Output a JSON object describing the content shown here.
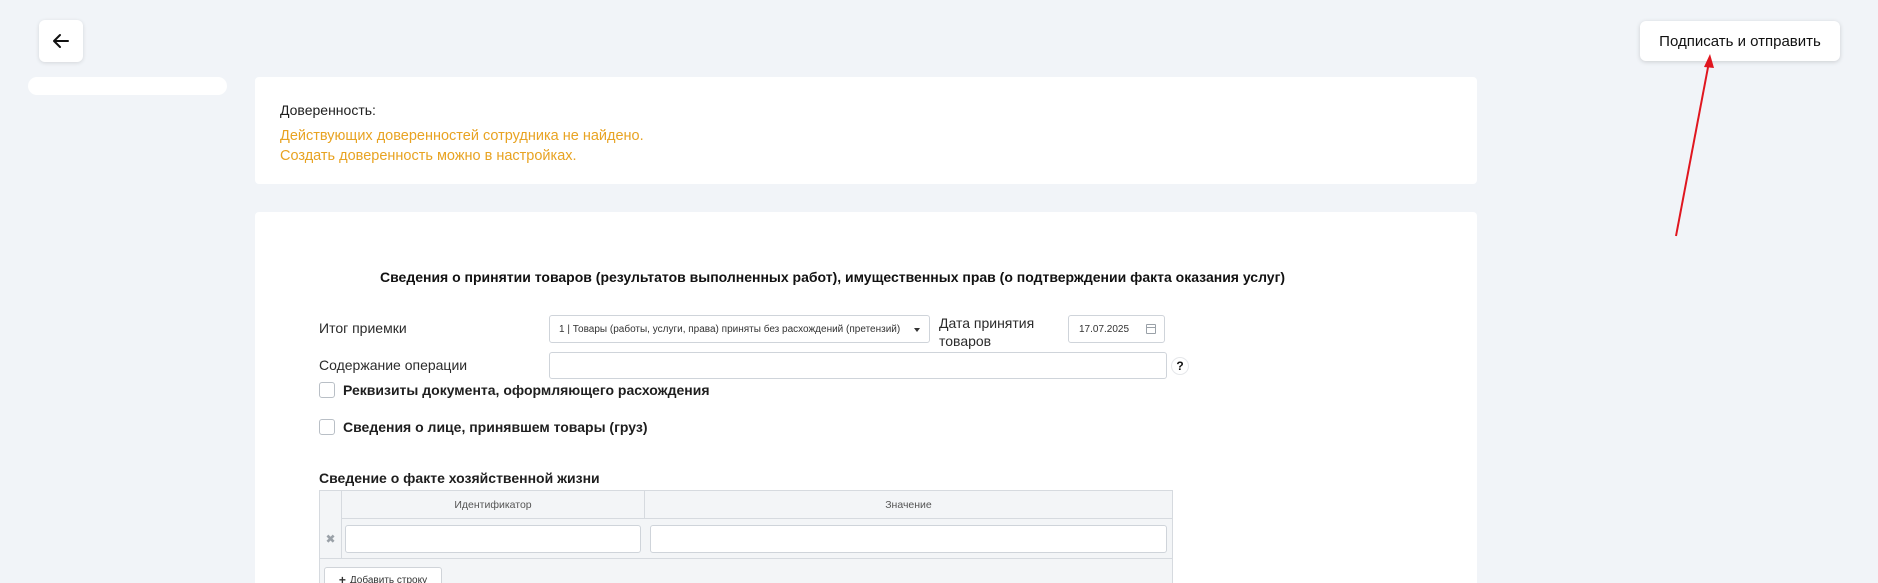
{
  "toolbar": {
    "back_icon": "arrow-left-icon",
    "sign_button_label": "Подписать и отправить"
  },
  "power_of_attorney": {
    "title": "Доверенность:",
    "warning_line1": "Действующих доверенностей сотрудника не найдено.",
    "warning_line2": "Создать доверенность можно в настройках.",
    "warning_color": "#e8a322"
  },
  "acceptance": {
    "section_title": "Сведения о принятии товаров (результатов выполненных работ), имущественных прав (о подтверждении факта оказания услуг)",
    "result_label": "Итог приемки",
    "result_value": "1 | Товары (работы, услуги, права) приняты без расхождений (претензий)",
    "date_label": "Дата принятия товаров",
    "date_value": "17.07.2025",
    "operation_label": "Содержание операции",
    "operation_value": "",
    "help_label": "?",
    "checkbox_discrepancy": "Реквизиты документа, оформляющего расхождения",
    "checkbox_receiver": "Сведения о лице, принявшем товары (груз)"
  },
  "facts": {
    "title": "Сведение о факте хозяйственной жизни",
    "columns": [
      "Идентификатор",
      "Значение"
    ],
    "rows": [
      {
        "id": "",
        "value": ""
      }
    ],
    "delete_glyph": "✖",
    "add_row_plus": "+",
    "add_row_label": "Добавить строку"
  }
}
